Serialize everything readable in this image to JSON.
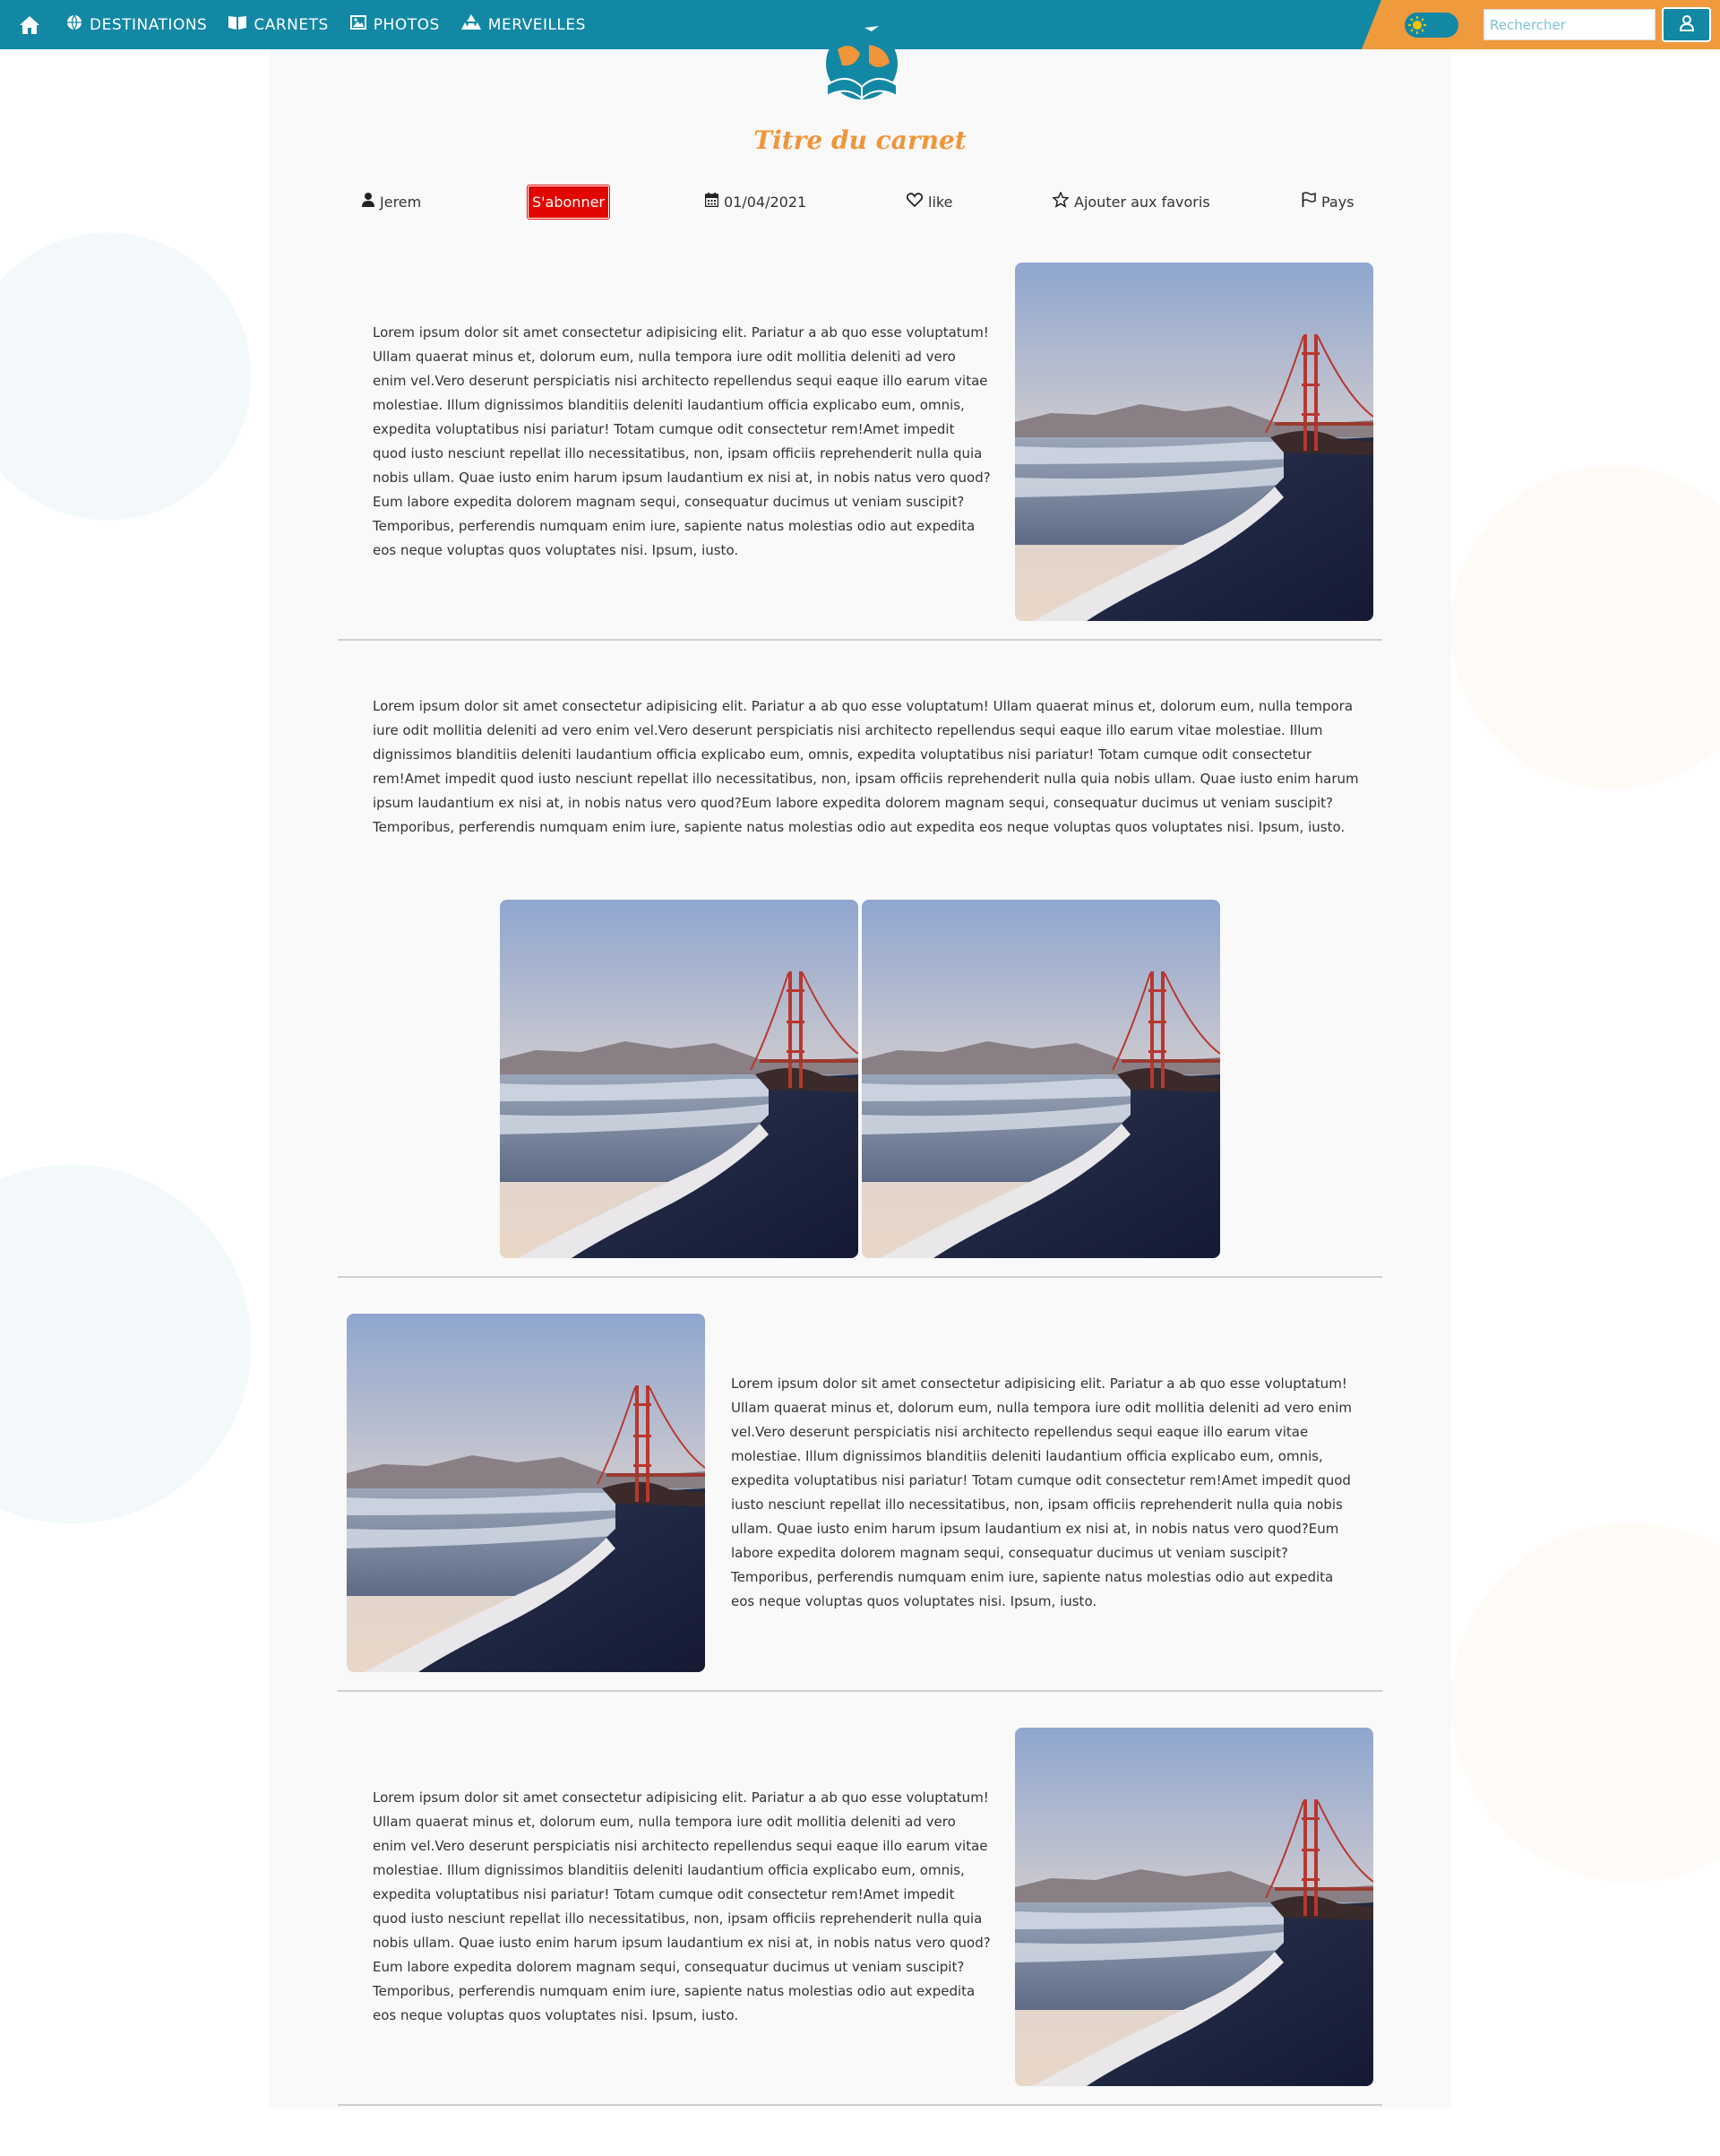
{
  "nav": {
    "items": [
      {
        "label": "DESTINATIONS",
        "icon": "globe-icon"
      },
      {
        "label": "CARNETS",
        "icon": "book-icon"
      },
      {
        "label": "PHOTOS",
        "icon": "image-icon"
      },
      {
        "label": "MERVEILLES",
        "icon": "monument-icon"
      }
    ],
    "search_placeholder": "Rechercher",
    "colors": {
      "primary": "#1288a4",
      "accent": "#f09a3e"
    }
  },
  "notebook": {
    "title": "Titre du carnet",
    "author": "Jerem",
    "subscribe_label": "S'abonner",
    "date": "01/04/2021",
    "like_label": "like",
    "favorites_label": "Ajouter aux favoris",
    "country_label": "Pays"
  },
  "sections": {
    "text": "Lorem ipsum dolor sit amet consectetur adipisicing elit. Pariatur a ab quo esse voluptatum! Ullam quaerat minus et, dolorum eum, nulla tempora iure odit mollitia deleniti ad vero enim vel.Vero deserunt perspiciatis nisi architecto repellendus sequi eaque illo earum vitae molestiae. Illum dignissimos blanditiis deleniti laudantium officia explicabo eum, omnis, expedita voluptatibus nisi pariatur! Totam cumque odit consectetur rem!Amet impedit quod iusto nesciunt repellat illo necessitatibus, non, ipsam officiis reprehenderit nulla quia nobis ullam. Quae iusto enim harum ipsum laudantium ex nisi at, in nobis natus vero quod?Eum labore expedita dolorem magnam sequi, consequatur ducimus ut veniam suscipit? Temporibus, perferendis numquam enim iure, sapiente natus molestias odio aut expedita eos neque voluptas quos voluptates nisi. Ipsum, iusto."
  }
}
